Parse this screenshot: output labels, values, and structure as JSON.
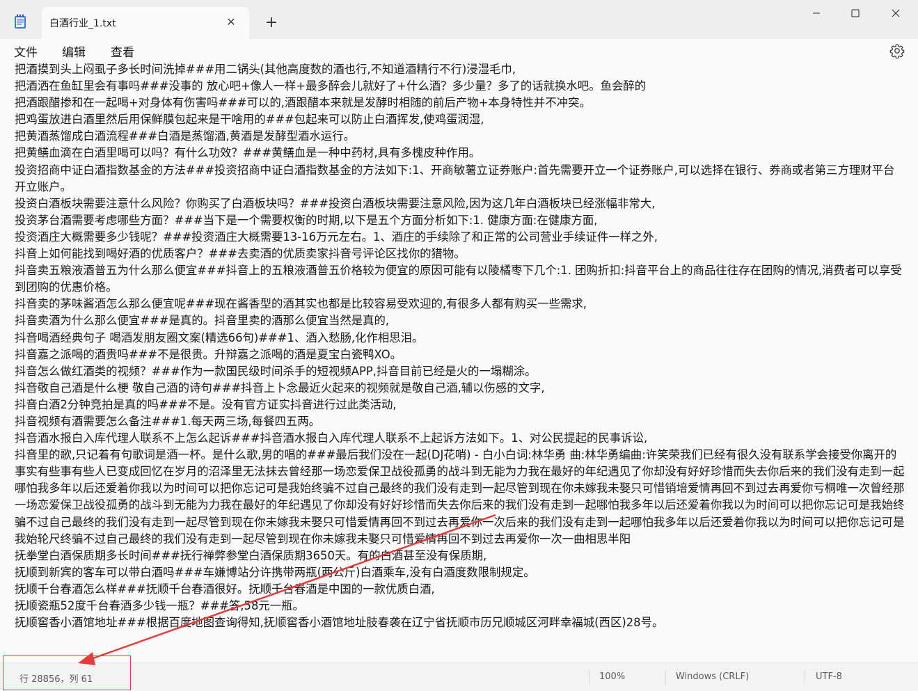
{
  "window": {
    "tab_title": "白酒行业_1.txt",
    "close_tab_glyph": "✕",
    "new_tab_glyph": "+"
  },
  "menu": {
    "file": "文件",
    "edit": "编辑",
    "view": "查看"
  },
  "editor": {
    "lines": [
      "把酒摸到头上闷虱子多长时间洗掉###用二锅头(其他高度数的酒也行,不知道酒精行不行)浸湿毛巾,",
      "把酒洒在鱼缸里会有事吗###没事的 放心吧+像人一样+最多醉会儿就好了+什么酒？多少量？多了的话就换水吧。鱼会醉的",
      "把酒跟醋掺和在一起喝+对身体有伤害吗###可以的,酒跟醋本来就是发酵时相随的前后产物+本身特性并不冲突。",
      "把鸡蛋放进白酒里然后用保鲜膜包起来是干啥用的###包起来可以防止白酒挥发,使鸡蛋润湿,",
      "把黄酒蒸馏成白酒流程###白酒是蒸馏酒,黄酒是发酵型酒水运行。",
      "把黄鳝血滴在白酒里喝可以吗？有什么功效？###黄鳝血是一种中药材,具有多槐皮种作用。",
      "投资招商中证白酒指数基金的方法###投资招商中证白酒指数基金的方法如下:1、开商敏薯立证券账户:首先需要开立一个证券账户,可以选择在银行、券商或者第三方理财平台开立账户。",
      "投资白酒板块需要注意什么风险？你购买了白酒板块吗？###投资白酒板块需要注意风险,因为这几年白酒板块已经涨幅非常大,",
      "投资茅台酒需要考虑哪些方面？###当下是一个需要权衡的时期,以下是五个方面分析如下:1. 健康方面:在健康方面,",
      "投资酒庄大概需要多少钱呢？###投资酒庄大概需要13-16万元左右。1、酒庄的手续除了和正常的公司营业手续证件一样之外,",
      "抖音上如何能找到喝好酒的优质客户？###去卖酒的优质卖家抖音号评论区找你的猎物。",
      "抖音卖五粮液酒普五为什么那么便宜###抖音上的五粮液酒普五价格较为便宜的原因可能有以陵橘枣下几个:1. 团购折扣:抖音平台上的商品往往存在团购的情况,消费者可以享受到团购的优惠价格。",
      "抖音卖的茅味酱酒怎么那么便宜呢###现在酱香型的酒其实也都是比较容易受欢迎的,有很多人都有购买一些需求,",
      "抖音卖酒为什么那么便宜###是真的。抖音里卖的酒那么便宜当然是真的,",
      "抖音喝酒经典句子 喝酒发朋友圈文案(精选66句)###1、酒入愁肠,化作相思泪。",
      "抖音嘉之派喝的酒贵吗###不是很贵。升辩嘉之派喝的酒是夏宝白瓷鸭XO。",
      "抖音怎么做红酒类的视频？###作为一款国民级时间杀手的短视频APP,抖音目前已经是火的一塌糊涂。",
      "抖音敬自己酒是什么梗 敬自己酒的诗句###抖音上卜念最近火起来的视频就是敬自己酒,辅以伤感的文字,",
      "抖音白酒2分钟竞拍是真的吗###不是。没有官方证实抖音进行过此类活动,",
      "抖音视频有酒需要怎么备注###1.每天两三场,每餐四五两。",
      "抖音酒水报白入库代理人联系不上怎么起诉###抖音酒水报白入库代理人联系不上起诉方法如下。1、对公民提起的民事诉讼,",
      "抖音里的歌,只记着有句歌词是酒一杯。是什么歌,男的唱的###最后我们没在一起(DJ花哨) - 白小白词:林华勇 曲:林华勇编曲:许笑荣我们已经有很久没有联系学会接受你离开的事实有些事有些人已变成回忆在岁月的沼泽里无法抹去曾经那一场恋爱保卫战役孤勇的战斗到无能为力我在最好的年纪遇见了你却没有好好珍惜而失去你后来的我们没有走到一起哪怕我多年以后还爱着你我以为时间可以把你忘记可是我始终骗不过自己最终的我们没有走到一起尽管到现在你未嫁我未娶只可惜销培爱情再回不到过去再爱你亏桐唯一次曾经那一场恋爱保卫战役孤勇的战斗到无能为力我在最好的年纪遇见了你却没有好好珍惜而失去你后来的我们没有走到一起哪怕我多年以后还爱着你我以为时间可以把你忘记可是我始终骗不过自己最终的我们没有走到一起尽管到现在你未嫁我未娶只可惜爱情再回不到过去再爱你一次后来的我们没有走到一起哪怕我多年以后还爱着你我以为时间可以把你忘记可是我始轮尺终骗不过自己最终的我们没有走到一起尽管到现在你未嫁我未娶只可惜爱情再回不到过去再爱你一次一曲相思半阳",
      "抚拳堂白酒保质期多长时间###抚行禅弊参堂白酒保质期3650天。有的白酒甚至没有保质期,",
      "抚顺到新宾的客车可以带白酒吗###车嫌博站分许携带两瓶(两公斤)白酒乘车,没有白酒度数限制规定。",
      "抚顺千台春酒怎么样###抚顺千台春酒很好。抚顺千台春酒是中国的一款优质白酒,",
      "抚顺瓷瓶52度千台春酒多少钱一瓶？###答,58元一瓶。",
      "抚顺窖香小酒馆地址###根据百度地图查询得知,抚顺窖香小酒馆地址肢春袭在辽宁省抚顺市历兄顺城区河畔幸福城(西区)28号。"
    ]
  },
  "status": {
    "position": "行 28856，列 61",
    "zoom": "100%",
    "line_ending": "Windows (CRLF)",
    "encoding": "UTF-8"
  },
  "colors": {
    "annotation": "#e53b3b",
    "text": "#1a1a1a"
  }
}
